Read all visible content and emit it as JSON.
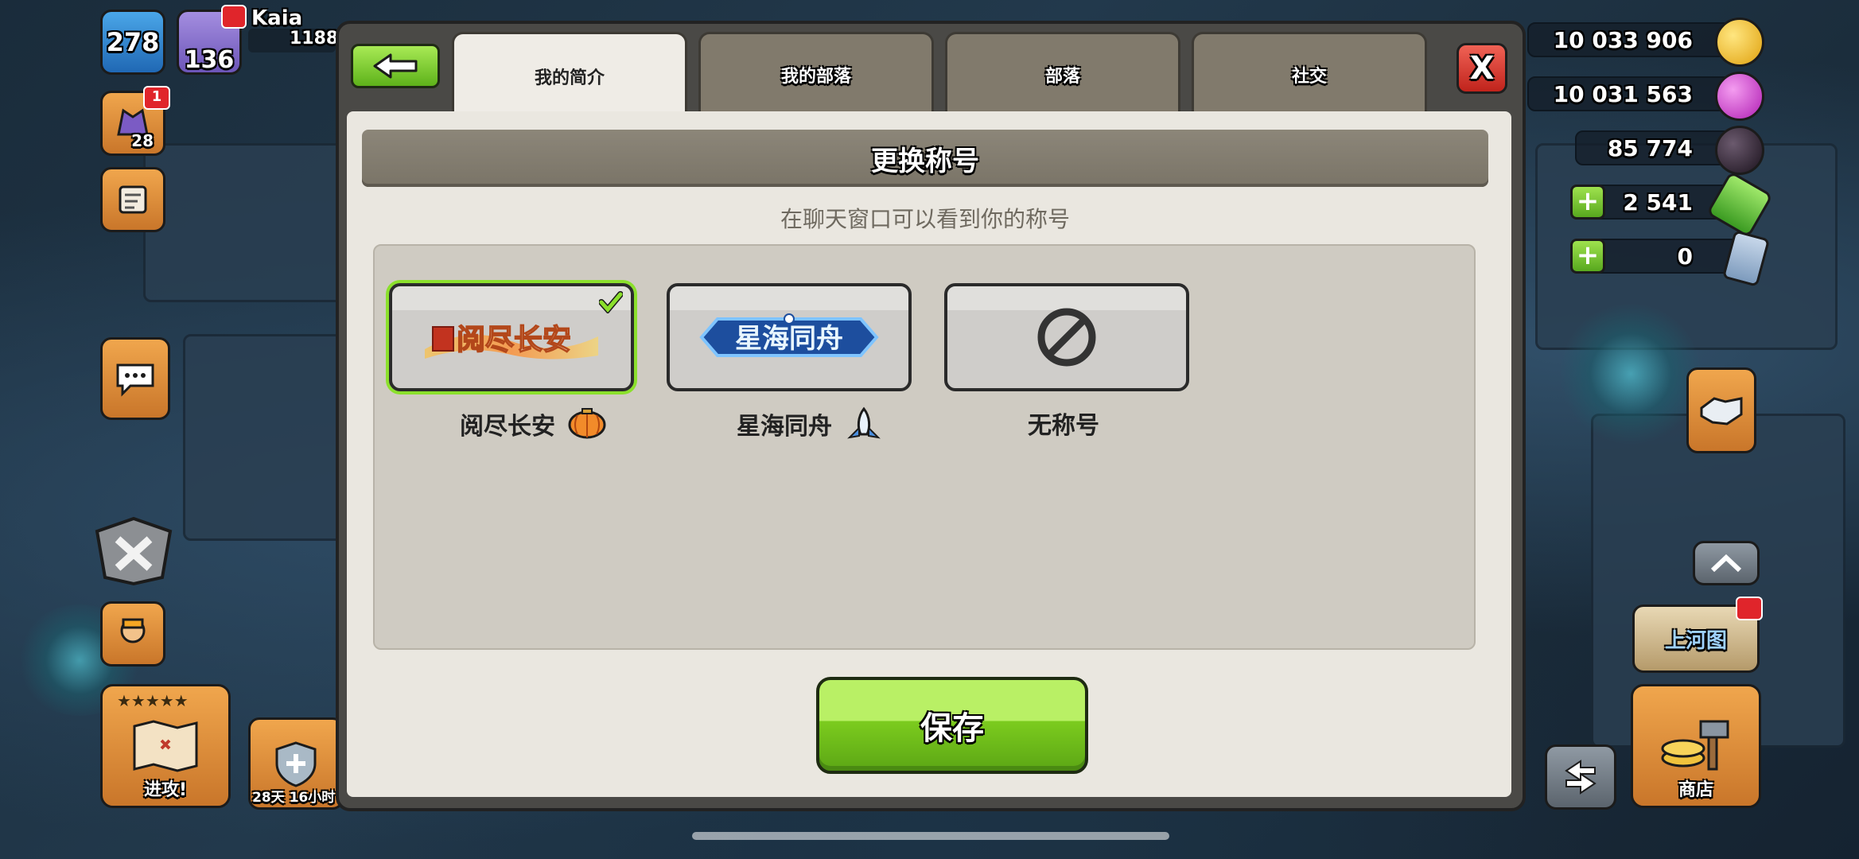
{
  "player": {
    "level": "278",
    "trophies": "136",
    "name": "Kaia",
    "score": "1188",
    "notification_count": "1"
  },
  "left_hud": {
    "clan_level": "28",
    "attack_label": "进攻!",
    "shield_label": "28天 16小时"
  },
  "resources": {
    "gold": "10 033 906",
    "elixir": "10 031 563",
    "dark_elixir": "85 774",
    "gems": "2 541",
    "tickets": "0"
  },
  "right_hud": {
    "shop_label": "商店",
    "event_label": "上河图"
  },
  "dialog": {
    "tabs": [
      {
        "label": "我的简介"
      },
      {
        "label": "我的部落"
      },
      {
        "label": "部落"
      },
      {
        "label": "社交"
      }
    ],
    "close_label": "X",
    "header": "更换称号",
    "subtitle": "在聊天窗口可以看到你的称号",
    "titles": [
      {
        "label": "阅尽长安",
        "banner": "阅尽长安",
        "icon": "lantern-icon",
        "selected": true
      },
      {
        "label": "星海同舟",
        "banner": "星海同舟",
        "icon": "rocket-icon",
        "selected": false
      },
      {
        "label": "无称号",
        "icon": "no-symbol-icon",
        "selected": false
      }
    ],
    "save_label": "保存"
  },
  "colors": {
    "accent_green": "#7ccc1e",
    "close_red": "#c0231c",
    "selected_outline": "#8be02c",
    "header_bar": "#8c8679"
  }
}
